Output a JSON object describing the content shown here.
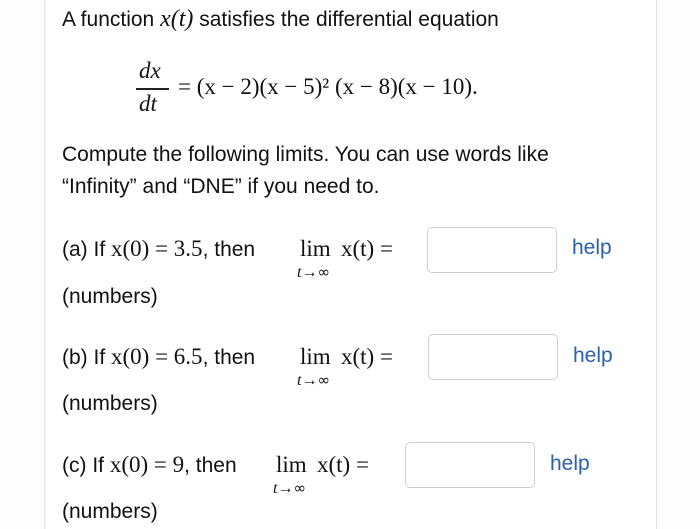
{
  "intro": {
    "prefix": "A function ",
    "func": "x(t)",
    "suffix": " satisfies the differential equation"
  },
  "equation": {
    "numerator": "dx",
    "denominator": "dt",
    "rhs": "= (x − 2)(x − 5)² (x − 8)(x − 10)."
  },
  "instructions": {
    "line1": "Compute the following limits. You can use words like",
    "line2": "“Infinity” and “DNE” if you need to."
  },
  "limit": {
    "operator": "lim",
    "var": "t",
    "arrow": "→",
    "infinity": "∞",
    "expression": "x(t) ="
  },
  "parts": [
    {
      "label": "(a) If ",
      "condition": "x(0) = 3.5",
      "then": ", then",
      "answer": "",
      "help": "help",
      "hint": "(numbers)"
    },
    {
      "label": "(b) If ",
      "condition": "x(0) = 6.5",
      "then": ", then",
      "answer": "",
      "help": "help",
      "hint": "(numbers)"
    },
    {
      "label": "(c) If ",
      "condition": "x(0) = 9",
      "then": ", then",
      "answer": "",
      "help": "help",
      "hint": "(numbers)"
    }
  ],
  "colors": {
    "help_link": "#2a5fb0",
    "input_border": "#cfcfcf"
  }
}
